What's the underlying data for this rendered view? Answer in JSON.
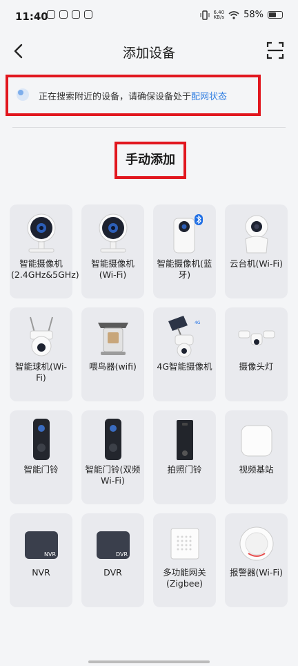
{
  "status_bar": {
    "time": "11:40",
    "net_speed_value": "6.40",
    "net_speed_unit": "KB/s",
    "battery": "58%"
  },
  "header": {
    "title": "添加设备",
    "back_icon": "chevron-left-icon",
    "scan_icon": "scan-icon"
  },
  "banner": {
    "text": "正在搜索附近的设备，请确保设备处于",
    "link": "配网状态"
  },
  "section_title": "手动添加",
  "devices": [
    {
      "label": "智能摄像机(2.4GHz&5GHz)",
      "icon": "indoor-camera-icon"
    },
    {
      "label": "智能摄像机(Wi-Fi)",
      "icon": "indoor-camera-icon"
    },
    {
      "label": "智能摄像机(蓝牙)",
      "icon": "bluetooth-camera-icon"
    },
    {
      "label": "云台机(Wi-Fi)",
      "icon": "ptz-camera-icon"
    },
    {
      "label": "智能球机(Wi-Fi)",
      "icon": "dome-camera-icon"
    },
    {
      "label": "喂鸟器(wifi)",
      "icon": "bird-feeder-icon"
    },
    {
      "label": "4G智能摄像机",
      "icon": "solar-4g-camera-icon"
    },
    {
      "label": "摄像头灯",
      "icon": "floodlight-camera-icon"
    },
    {
      "label": "智能门铃",
      "icon": "doorbell-icon"
    },
    {
      "label": "智能门铃(双频Wi-Fi)",
      "icon": "doorbell-icon"
    },
    {
      "label": "拍照门铃",
      "icon": "photo-doorbell-icon"
    },
    {
      "label": "视频基站",
      "icon": "base-station-icon"
    },
    {
      "label": "NVR",
      "icon": "nvr-icon",
      "badge": "NVR"
    },
    {
      "label": "DVR",
      "icon": "dvr-icon",
      "badge": "DVR"
    },
    {
      "label": "多功能网关(Zigbee)",
      "icon": "gateway-icon"
    },
    {
      "label": "报警器(Wi-Fi)",
      "icon": "siren-icon"
    }
  ]
}
